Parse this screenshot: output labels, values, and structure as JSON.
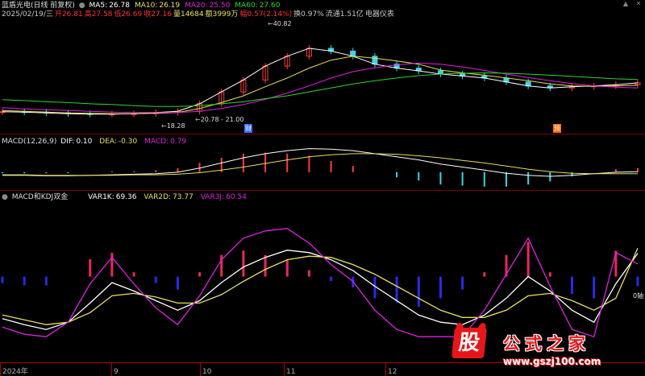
{
  "main": {
    "name": "蓝盾光电(日线 前复权)",
    "ma": [
      {
        "label": "MA5:",
        "value": "26.78",
        "color": "#ffffff"
      },
      {
        "label": "MA10:",
        "value": "26.19",
        "color": "#e6e05a"
      },
      {
        "label": "MA20:",
        "value": "25.50",
        "color": "#e020e0"
      },
      {
        "label": "MA60:",
        "value": "27.60",
        "color": "#2cd62c"
      }
    ],
    "bar": [
      {
        "text": "2025/02/19/三",
        "color": "#c8c8c8"
      },
      {
        "text": "开26.81",
        "color": "#ff3030"
      },
      {
        "text": "高27.58",
        "color": "#ff3030"
      },
      {
        "text": "低26.69",
        "color": "#ff3030"
      },
      {
        "text": "收27.16",
        "color": "#ff3030"
      },
      {
        "text": "量14684",
        "color": "#e6e05a"
      },
      {
        "text": "额3999万",
        "color": "#e6e05a"
      },
      {
        "text": "幅0.57(2.14%)",
        "color": "#ff3030"
      },
      {
        "text": "换0.97%",
        "color": "#c8c8c8"
      },
      {
        "text": "流通1.51亿",
        "color": "#c8c8c8"
      },
      {
        "text": "电器仪表",
        "color": "#c8c8c8"
      }
    ],
    "high_label": "40.82",
    "low_label": "18.28",
    "range_label": "20.78 - 21.00",
    "events": [
      {
        "label": "财",
        "color": "#3a6cff"
      },
      {
        "label": "预",
        "color": "#ff6a00"
      }
    ]
  },
  "macd": {
    "params": "MACD(12,26,9)",
    "dif": {
      "label": "DIF:",
      "value": "0.10",
      "color": "#ffffff"
    },
    "dea": {
      "label": "DEA:",
      "value": "-0.30",
      "color": "#e6e05a"
    },
    "macd": {
      "label": "MACD:",
      "value": "0.79",
      "color": "#e020e0"
    }
  },
  "kdj": {
    "title": "MACD和KDJ双金",
    "var1k": {
      "label": "VAR1K:",
      "value": "69.36",
      "color": "#ffffff"
    },
    "var2d": {
      "label": "VAR2D:",
      "value": "73.77",
      "color": "#e6e05a"
    },
    "var3j": {
      "label": "VAR3J:",
      "value": "60.54",
      "color": "#e020e0"
    },
    "zero_label": "0轴"
  },
  "xaxis": [
    "2024年",
    "9",
    "10",
    "11",
    "12"
  ],
  "watermark": {
    "logo": "股",
    "title": "公式之家",
    "url": "www.gszj100.com"
  },
  "chart_data": [
    {
      "type": "candlestick",
      "title": "蓝盾光电(日线 前复权)",
      "series": [
        {
          "name": "MA5",
          "values": [
            19.5,
            19.4,
            19.2,
            19.0,
            18.9,
            18.9,
            19.0,
            19.3,
            19.6,
            21.5,
            24.5,
            27.5,
            31.0,
            33.5,
            35.5,
            34.8,
            33.5,
            31.5,
            30.5,
            29.8,
            29.0,
            28.5,
            28.0,
            27.0,
            26.0,
            25.5,
            25.8,
            26.0,
            26.3,
            26.78
          ]
        },
        {
          "name": "MA10",
          "values": [
            19.8,
            19.6,
            19.4,
            19.2,
            19.1,
            19.0,
            19.0,
            19.1,
            19.3,
            20.3,
            21.8,
            23.5,
            25.8,
            28.0,
            30.5,
            32.5,
            33.5,
            33.0,
            32.3,
            31.5,
            30.0,
            29.3,
            28.7,
            28.0,
            27.3,
            26.5,
            26.0,
            25.9,
            26.0,
            26.19
          ]
        },
        {
          "name": "MA20",
          "values": [
            20.5,
            20.2,
            20.0,
            19.8,
            19.6,
            19.4,
            19.3,
            19.3,
            19.3,
            19.6,
            20.3,
            21.3,
            22.6,
            24.2,
            26.0,
            28.0,
            29.6,
            30.6,
            31.3,
            31.8,
            31.5,
            30.8,
            29.9,
            29.0,
            28.1,
            27.3,
            26.6,
            26.0,
            25.7,
            25.5
          ]
        },
        {
          "name": "MA60",
          "values": [
            22.5,
            22.3,
            22.0,
            21.8,
            21.5,
            21.3,
            21.0,
            20.8,
            20.8,
            21.0,
            21.5,
            22.0,
            22.8,
            23.5,
            24.5,
            25.5,
            26.5,
            27.3,
            28.0,
            28.6,
            29.0,
            29.2,
            29.3,
            29.2,
            29.0,
            28.7,
            28.4,
            28.1,
            27.8,
            27.6
          ]
        }
      ],
      "annotations": {
        "high": 40.82,
        "low": 18.28,
        "range": "20.78 - 21.00"
      }
    },
    {
      "type": "bar",
      "title": "MACD(12,26,9)",
      "series": [
        {
          "name": "DIF",
          "values": [
            -0.6,
            -0.6,
            -0.7,
            -0.7,
            -0.6,
            -0.5,
            -0.4,
            -0.3,
            0.0,
            0.8,
            1.8,
            2.8,
            3.6,
            4.2,
            4.6,
            4.5,
            4.2,
            3.6,
            3.0,
            2.4,
            1.6,
            1.0,
            0.4,
            -0.2,
            -0.6,
            -0.8,
            -0.6,
            -0.3,
            0.0,
            0.1
          ]
        },
        {
          "name": "DEA",
          "values": [
            -0.5,
            -0.5,
            -0.6,
            -0.6,
            -0.6,
            -0.6,
            -0.5,
            -0.5,
            -0.4,
            -0.1,
            0.4,
            1.0,
            1.7,
            2.4,
            3.0,
            3.4,
            3.6,
            3.6,
            3.5,
            3.2,
            2.8,
            2.3,
            1.8,
            1.2,
            0.6,
            0.1,
            -0.2,
            -0.3,
            -0.3,
            -0.3
          ]
        },
        {
          "name": "MACD",
          "values": [
            -0.2,
            -0.2,
            -0.2,
            -0.2,
            0.0,
            0.2,
            0.2,
            0.4,
            0.8,
            1.8,
            2.8,
            3.6,
            3.8,
            3.6,
            3.2,
            2.2,
            1.2,
            0.0,
            -1.0,
            -1.6,
            -2.4,
            -2.6,
            -2.8,
            -2.8,
            -2.4,
            -1.8,
            -0.8,
            0.0,
            0.6,
            0.79
          ]
        }
      ]
    },
    {
      "type": "line",
      "title": "MACD和KDJ双金",
      "series": [
        {
          "name": "VAR1K",
          "values": [
            15,
            10,
            6,
            12,
            28,
            45,
            38,
            30,
            22,
            30,
            45,
            58,
            66,
            72,
            70,
            64,
            55,
            42,
            30,
            18,
            12,
            10,
            18,
            32,
            50,
            38,
            22,
            12,
            44,
            69.36
          ]
        },
        {
          "name": "VAR2D",
          "values": [
            18,
            14,
            10,
            12,
            20,
            34,
            36,
            33,
            28,
            28,
            35,
            46,
            56,
            64,
            67,
            66,
            60,
            52,
            42,
            32,
            22,
            16,
            16,
            22,
            34,
            36,
            30,
            22,
            32,
            73.77
          ]
        },
        {
          "name": "VAR3J",
          "values": [
            8,
            2,
            0,
            12,
            44,
            66,
            44,
            24,
            10,
            34,
            64,
            82,
            88,
            90,
            78,
            60,
            46,
            22,
            6,
            0,
            0,
            0,
            22,
            52,
            82,
            42,
            6,
            0,
            70,
            60.54
          ]
        }
      ]
    }
  ]
}
